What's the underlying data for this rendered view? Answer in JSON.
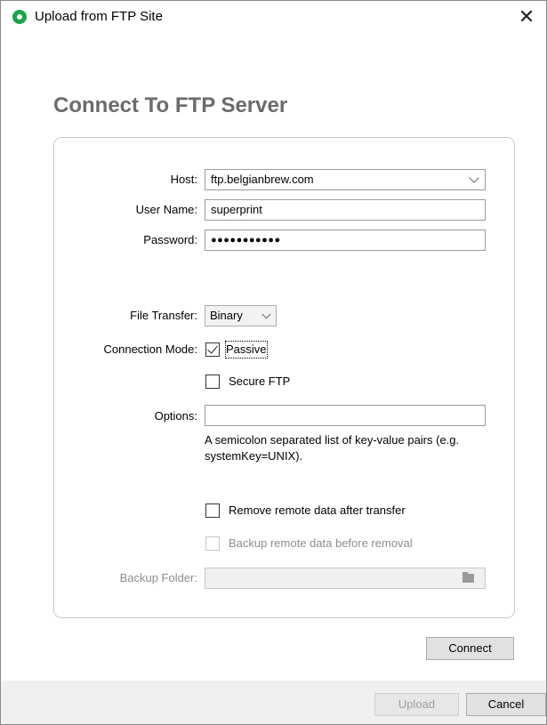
{
  "window": {
    "title": "Upload from FTP Site",
    "close_glyph": "✕"
  },
  "heading": "Connect To FTP Server",
  "form": {
    "host": {
      "label": "Host:",
      "value": "ftp.belgianbrew.com"
    },
    "username": {
      "label": "User Name:",
      "value": "superprint"
    },
    "password": {
      "label": "Password:",
      "value": "●●●●●●●●●●●"
    },
    "file_transfer": {
      "label": "File Transfer:",
      "value": "Binary"
    },
    "connection_mode": {
      "label": "Connection Mode:",
      "passive_label": "Passive",
      "passive_checked": true
    },
    "secure_ftp": {
      "label": "Secure FTP",
      "checked": false
    },
    "options": {
      "label": "Options:",
      "value": "",
      "hint": "A semicolon separated list of key-value pairs (e.g. systemKey=UNIX)."
    },
    "remove_remote": {
      "label": "Remove remote data after transfer",
      "checked": false
    },
    "backup_remote": {
      "label": "Backup remote data before removal",
      "checked": false,
      "disabled": true
    },
    "backup_folder": {
      "label": "Backup Folder:",
      "value": ""
    }
  },
  "buttons": {
    "connect": "Connect",
    "upload": "Upload",
    "cancel": "Cancel"
  },
  "icons": {
    "app": "app-status-icon",
    "folder": "folder-icon",
    "close": "close-icon"
  },
  "colors": {
    "app_icon": "#1aa34a",
    "heading": "#6b6b6b",
    "footer": "#f0f0f0"
  }
}
